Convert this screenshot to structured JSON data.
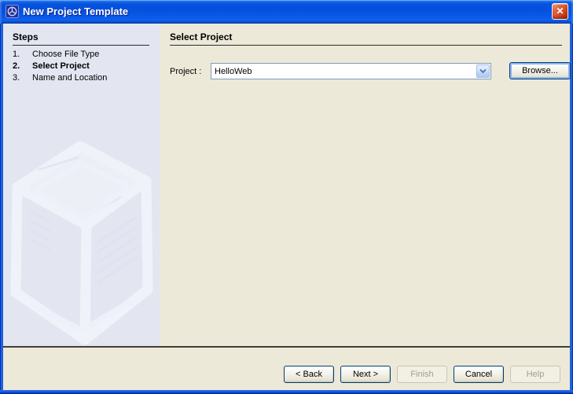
{
  "window": {
    "title": "New Project Template",
    "app_icon": "netbeans-cube-icon",
    "close_glyph": "✕"
  },
  "sidebar": {
    "header": "Steps",
    "steps": [
      {
        "num": "1.",
        "label": "Choose File Type",
        "current": false
      },
      {
        "num": "2.",
        "label": "Select Project",
        "current": true
      },
      {
        "num": "3.",
        "label": "Name and Location",
        "current": false
      }
    ]
  },
  "main": {
    "header": "Select Project",
    "project_label": "Project :",
    "project_value": "HelloWeb",
    "browse_label": "Browse..."
  },
  "footer": {
    "buttons": [
      {
        "label": "< Back",
        "enabled": true
      },
      {
        "label": "Next >",
        "enabled": true
      },
      {
        "label": "Finish",
        "enabled": false
      },
      {
        "label": "Cancel",
        "enabled": true
      },
      {
        "label": "Help",
        "enabled": false
      }
    ]
  },
  "colors": {
    "titlebar_blue": "#0653dd",
    "frame_blue": "#1a5cdd",
    "sidebar_bg": "#e3e6f1",
    "panel_bg": "#ece9d8",
    "combo_border": "#7f9db9",
    "button_border": "#003c74",
    "disabled_text": "#a09d92",
    "close_red": "#d94e28"
  }
}
